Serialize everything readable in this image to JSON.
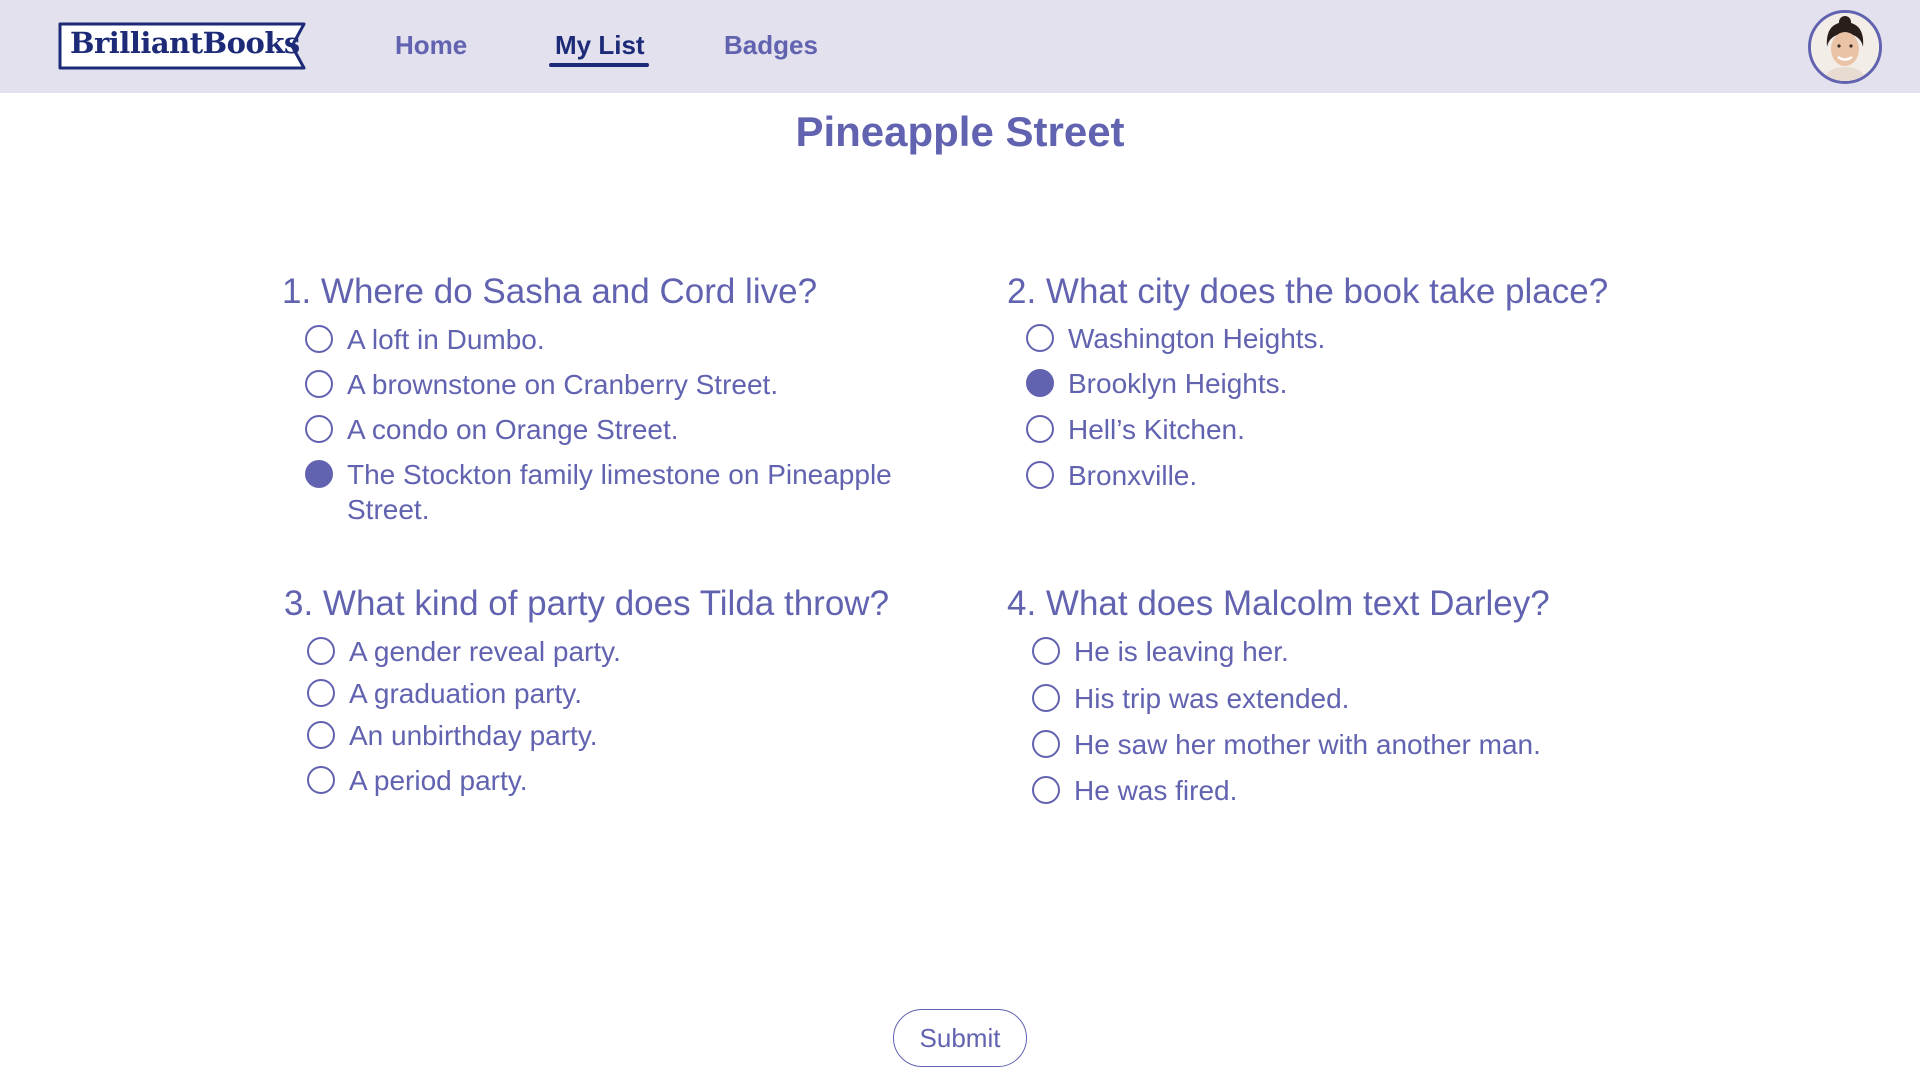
{
  "brand": {
    "logo_text": "BrilliantBooks"
  },
  "nav": {
    "home": "Home",
    "my_list": "My List",
    "badges": "Badges"
  },
  "page_title": "Pineapple Street",
  "questions": [
    {
      "title": "1. Where do Sasha and Cord live?",
      "options": [
        {
          "label": "A loft in Dumbo.",
          "selected": false
        },
        {
          "label": "A brownstone on Cranberry Street.",
          "selected": false
        },
        {
          "label": "A condo on Orange Street.",
          "selected": false
        },
        {
          "label": "The Stockton family limestone on Pineapple Street.",
          "selected": true
        }
      ]
    },
    {
      "title": "2. What city does the book take place?",
      "options": [
        {
          "label": "Washington Heights.",
          "selected": false
        },
        {
          "label": "Brooklyn Heights.",
          "selected": true
        },
        {
          "label": "Hell’s Kitchen.",
          "selected": false
        },
        {
          "label": "Bronxville.",
          "selected": false
        }
      ]
    },
    {
      "title": "3. What kind of party does Tilda throw?",
      "options": [
        {
          "label": "A gender reveal party.",
          "selected": false
        },
        {
          "label": "A graduation party.",
          "selected": false
        },
        {
          "label": "An unbirthday party.",
          "selected": false
        },
        {
          "label": "A period party.",
          "selected": false
        }
      ]
    },
    {
      "title": "4. What does Malcolm text Darley?",
      "options": [
        {
          "label": "He is leaving her.",
          "selected": false
        },
        {
          "label": "His trip was extended.",
          "selected": false
        },
        {
          "label": "He saw her mother with another man.",
          "selected": false
        },
        {
          "label": "He was fired.",
          "selected": false
        }
      ]
    }
  ],
  "submit_label": "Submit",
  "colors": {
    "accent": "#6263b0",
    "brand_navy": "#1c2a78",
    "header_bg": "#e2e1ed"
  }
}
